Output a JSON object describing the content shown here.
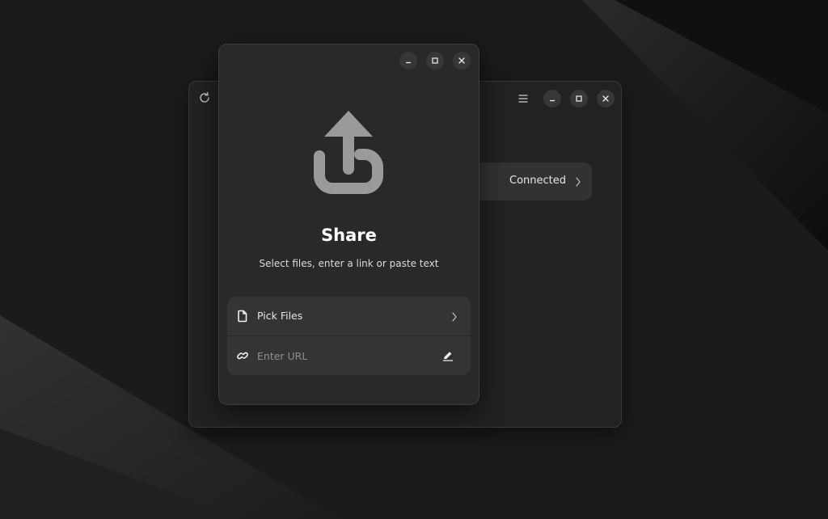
{
  "desktop": {
    "wallpaper": "dark-geometric"
  },
  "back_window": {
    "refresh_icon": "refresh-icon",
    "menu_icon": "hamburger-menu-icon",
    "row": {
      "label": "Connected",
      "chevron_icon": "chevron-right-icon"
    },
    "controls": [
      "minimize-icon",
      "maximize-icon",
      "close-icon"
    ]
  },
  "share_dialog": {
    "controls": [
      "minimize-icon",
      "maximize-icon",
      "close-icon"
    ],
    "hero_icon": "share-upload-icon",
    "title": "Share",
    "subtitle": "Select files, enter a link or paste text",
    "pick_files": {
      "label": "Pick Files",
      "icon": "file-icon",
      "chevron_icon": "chevron-right-icon"
    },
    "url_entry": {
      "placeholder": "Enter URL",
      "value": "",
      "icon": "link-icon",
      "action_icon": "edit-pencil-icon"
    }
  },
  "colors": {
    "dialog_bg": "#29292c",
    "list_bg": "#343437",
    "hero_icon": "#9a9a9d",
    "text": "#e6e6e6"
  }
}
